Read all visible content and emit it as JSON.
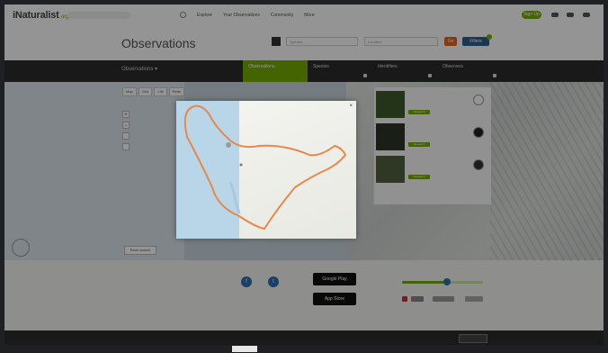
{
  "header": {
    "logo": "iNaturalist",
    "search_placeholder": "Search",
    "nav": [
      "Explore",
      "Your Observations",
      "Community",
      "More"
    ],
    "signup": "Sign Up"
  },
  "title_row": {
    "title": "Observations",
    "species_placeholder": "Species",
    "place_placeholder": "Location",
    "go_label": "Go",
    "filters_label": "Filters"
  },
  "stats": {
    "scope": "Observations",
    "tabs": [
      {
        "num": "",
        "label": "Observations"
      },
      {
        "num": "",
        "label": "Species"
      },
      {
        "num": "",
        "label": "Identifiers"
      },
      {
        "num": "",
        "label": "Observers"
      }
    ]
  },
  "map": {
    "toolbar": [
      "Map",
      "Grid",
      "List",
      "Redo"
    ],
    "zoom_in": "+",
    "zoom_out": "−",
    "redo_search": "Redo search",
    "attribution": ""
  },
  "results": [
    {
      "name": "",
      "sub": "",
      "grade": "Research",
      "photo_color": "#3e5a2c"
    },
    {
      "name": "",
      "sub": "",
      "grade": "Research",
      "photo_color": "#2b3526"
    },
    {
      "name": "",
      "sub": "",
      "grade": "Research",
      "photo_color": "#51613f"
    }
  ],
  "modal": {
    "close": "×",
    "labels": []
  },
  "footer": {
    "col1": [],
    "col2": [],
    "app_store": "App Store",
    "google_play": "Google Play",
    "slider_value": 0.55
  },
  "bottom": {
    "items": [],
    "language": ""
  },
  "colors": {
    "brand": "#74ac00",
    "outline": "#e8884a",
    "dark_bar": "#2b2b2b"
  }
}
